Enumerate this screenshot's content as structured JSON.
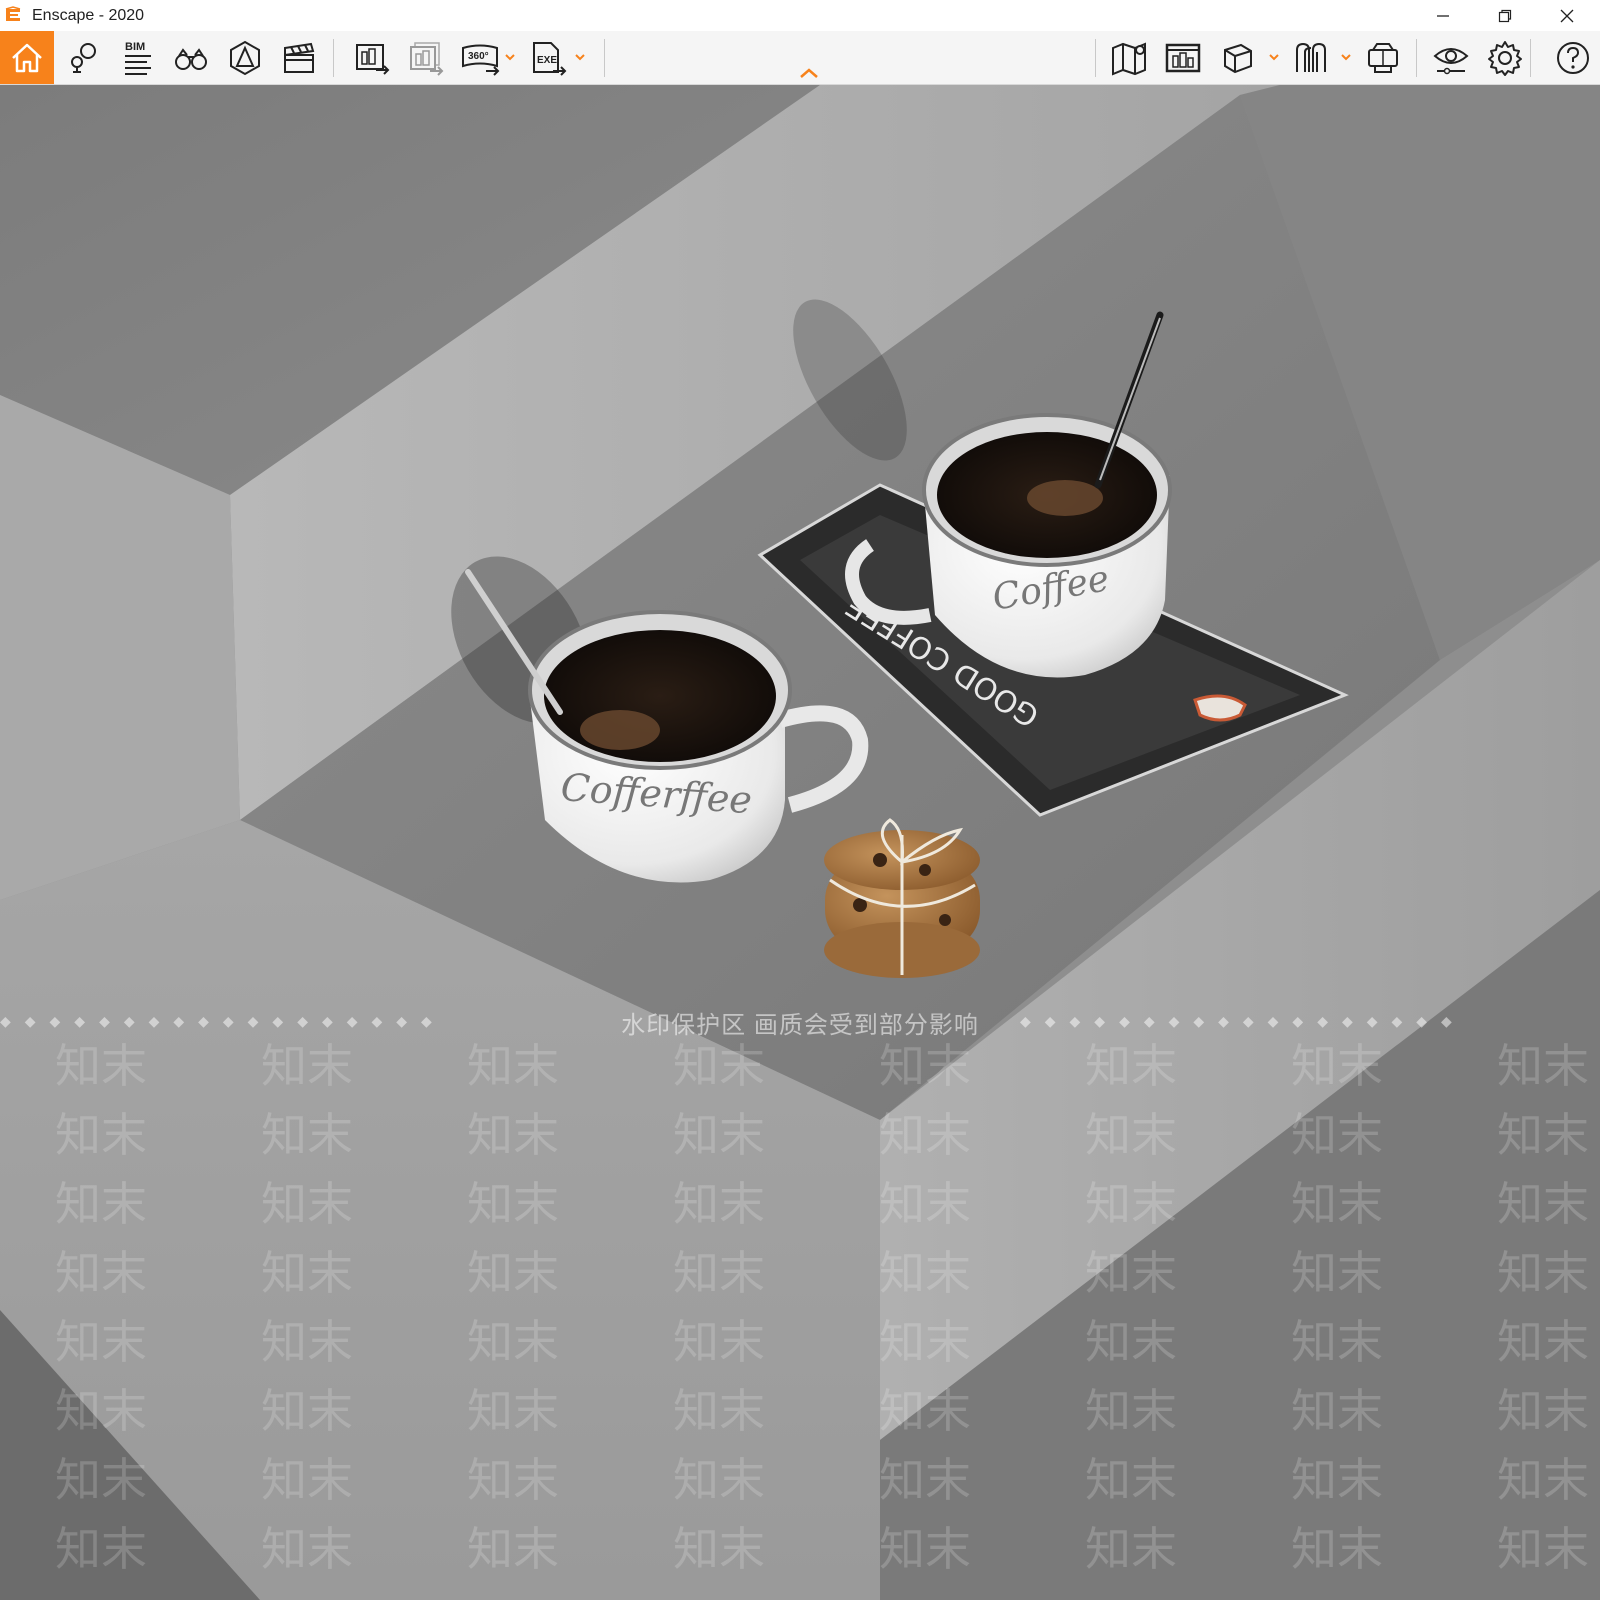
{
  "window": {
    "title": "Enscape - 2020",
    "controls": [
      "minimize",
      "restore",
      "close"
    ]
  },
  "toolbar": {
    "left_buttons": [
      {
        "name": "home",
        "icon": "home-icon",
        "active": true
      },
      {
        "name": "views",
        "icon": "map-pin-icon"
      },
      {
        "name": "bim",
        "icon": "bim-list-icon",
        "label": "BIM"
      },
      {
        "name": "asset-library",
        "icon": "binoculars-icon"
      },
      {
        "name": "atmosphere",
        "icon": "atmosphere-icon"
      },
      {
        "name": "video-editor",
        "icon": "clapperboard-icon"
      },
      {
        "name": "render-image",
        "icon": "render-image-icon"
      },
      {
        "name": "batch-render",
        "icon": "batch-render-icon"
      },
      {
        "name": "panorama",
        "icon": "panorama-icon",
        "label": "360°"
      },
      {
        "name": "export-exe",
        "icon": "exe-export-icon",
        "label": "EXE"
      }
    ],
    "right_buttons": [
      {
        "name": "map",
        "icon": "map-icon"
      },
      {
        "name": "render-window",
        "icon": "render-window-icon"
      },
      {
        "name": "cube",
        "icon": "cube-icon"
      },
      {
        "name": "collaboration",
        "icon": "collaboration-icon"
      },
      {
        "name": "vr-headset",
        "icon": "vr-headset-icon"
      },
      {
        "name": "visual-settings",
        "icon": "eye-icon"
      },
      {
        "name": "settings",
        "icon": "gear-icon"
      },
      {
        "name": "help",
        "icon": "help-icon"
      }
    ],
    "accent": "#f7821b"
  },
  "scene": {
    "mug_left_text": "Cofferffee",
    "mug_right_text": "Coffee",
    "coaster_text": "GOOD COFFEE"
  },
  "watermark": {
    "banner": "水印保护区   画质会受到部分影响",
    "mark": "知末"
  }
}
